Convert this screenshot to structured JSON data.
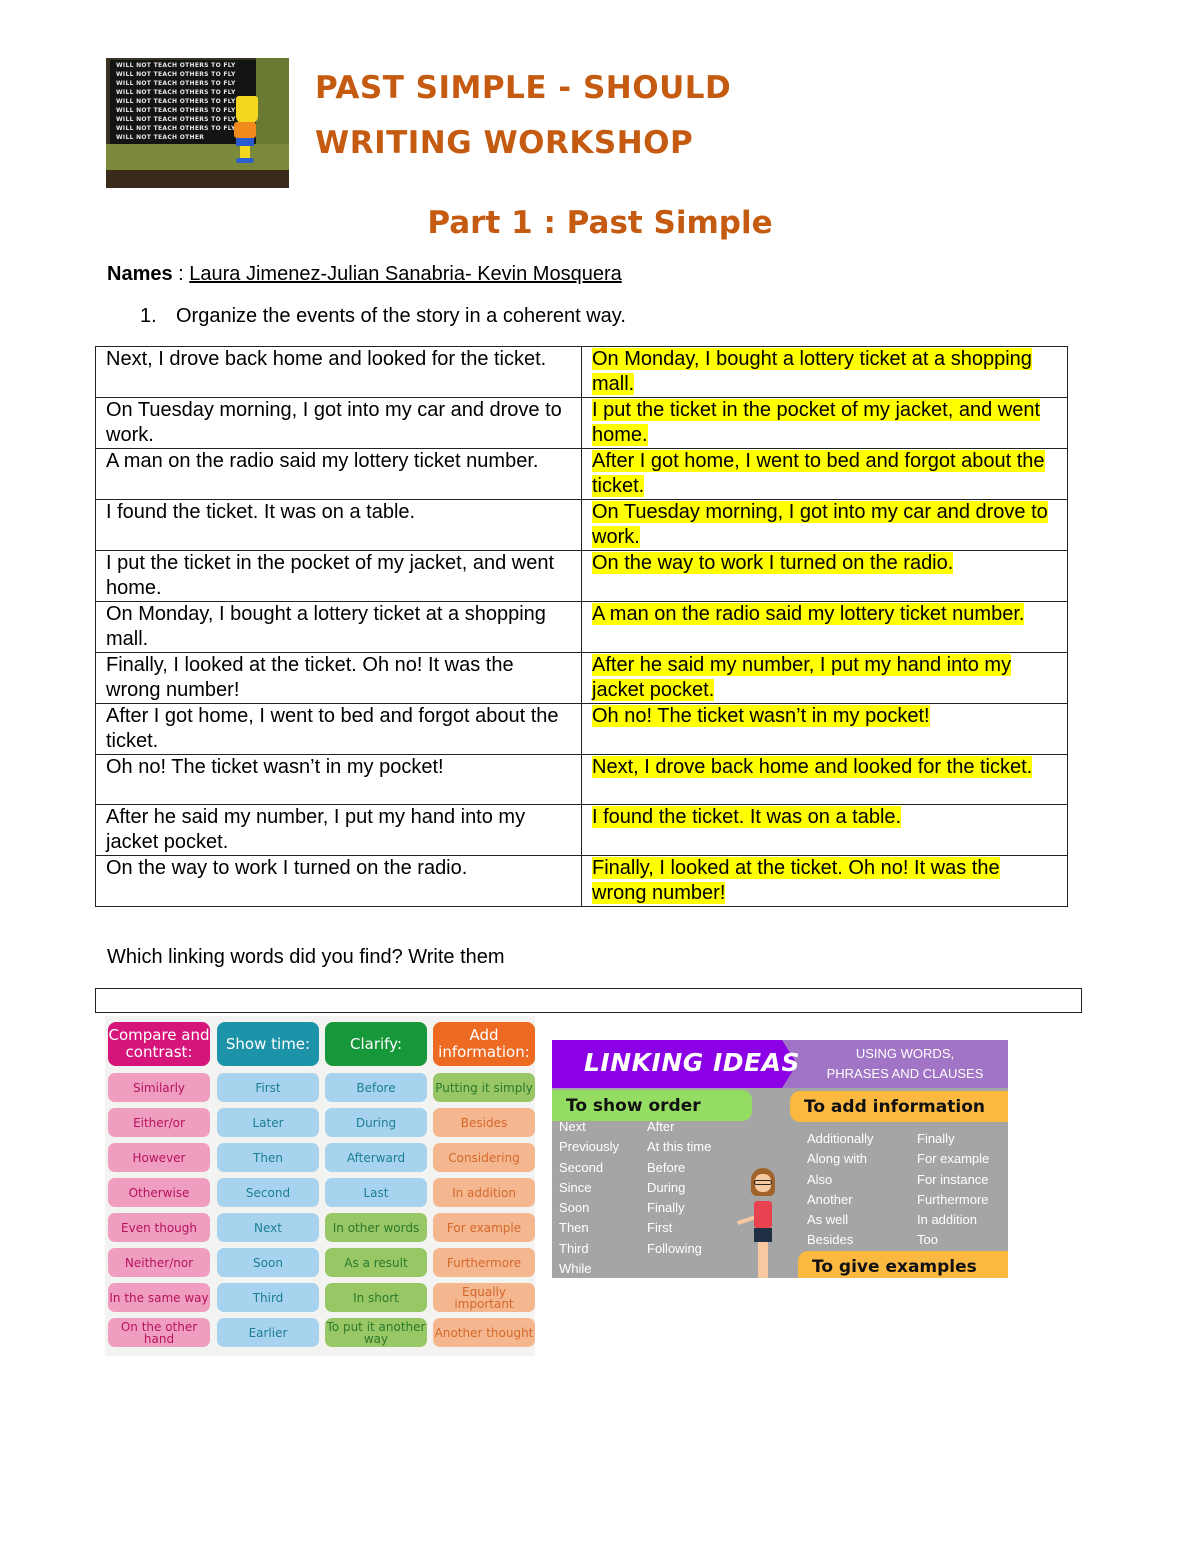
{
  "header": {
    "image": {
      "description": "Bart Simpson writing on a chalkboard",
      "chalk_lines": [
        "WILL NOT TEACH OTHERS TO FLY",
        "WILL NOT TEACH OTHERS TO FLY",
        "WILL NOT TEACH OTHERS TO FLY",
        "WILL NOT TEACH OTHERS TO FLY",
        "WILL NOT TEACH OTHERS TO FLY",
        "WILL NOT TEACH OTHERS TO FLY",
        "WILL NOT TEACH OTHERS TO FLY",
        "WILL NOT TEACH OTHERS TO FLY",
        "WILL NOT TEACH OTHER"
      ]
    },
    "title_line1": "PAST SIMPLE - SHOULD",
    "title_line2": "WRITING WORKSHOP",
    "part_title": "Part 1 : Past Simple",
    "accent_color": "#c55a11"
  },
  "names": {
    "label": "Names",
    "separator": " : ",
    "value": "Laura Jimenez-Julian Sanabria- Kevin Mosquera"
  },
  "instruction": {
    "number": "1.",
    "text": "Organize the events of the story in a coherent way."
  },
  "story_table": {
    "highlight_color": "#ffff00",
    "rows": [
      {
        "left": "Next, I drove back home and looked for the ticket.",
        "right": "On Monday, I bought a lottery ticket at a shopping mall."
      },
      {
        "left": "On Tuesday morning, I got into my car and drove to work.",
        "right": "I put the ticket in the pocket of my jacket, and went home."
      },
      {
        "left": "A man on the radio said my lottery ticket number.",
        "right": "After I got home, I went to bed and forgot about the ticket."
      },
      {
        "left": "I found the ticket. It was on a table.",
        "right": "On Tuesday morning, I got into my car and drove to work."
      },
      {
        "left": "I put the ticket in the pocket of my jacket, and went home.",
        "right": "On the way to work I turned on the radio."
      },
      {
        "left": "On Monday, I bought a lottery ticket at a shopping mall.",
        "right": "A man on the radio said my lottery ticket number."
      },
      {
        "left": "Finally, I looked at the ticket. Oh no! It was the wrong number!",
        "right": "After he said my number, I put my hand into my jacket pocket."
      },
      {
        "left": "After I got home, I went to bed and forgot about the ticket.",
        "right": "Oh no!  The ticket wasn’t in my pocket!"
      },
      {
        "left": "Oh no! The ticket wasn’t in my pocket!",
        "right": "Next, I drove back home and looked for the ticket."
      },
      {
        "left": "After he said my number, I put my hand into my jacket pocket.",
        "right": "I found the ticket.  It was on a table."
      },
      {
        "left": "On the way to work I turned on the radio.",
        "right": "Finally, I looked at the ticket.  Oh no!  It was the wrong number! "
      }
    ]
  },
  "question": {
    "text": "Which linking words did you find? Write them",
    "answer_value": ""
  },
  "linking_words_grid": {
    "columns": [
      {
        "heading": "Compare and contrast:",
        "color": "#d6157a",
        "pill_style": "pink",
        "items": [
          "Similarly",
          "Either/or",
          "However",
          "Otherwise",
          "Even though",
          "Neither/nor",
          "In the same way",
          "On the other hand"
        ]
      },
      {
        "heading": "Show time:",
        "color": "#1d93a9",
        "pill_style": "blue",
        "items": [
          "First",
          "Later",
          "Then",
          "Second",
          "Next",
          "Soon",
          "Third",
          "Earlier"
        ]
      },
      {
        "heading": "Clarify:",
        "color": "#16973a",
        "pill_style": "mixed",
        "items": [
          "Before",
          "During",
          "Afterward",
          "Last",
          "In other words",
          "As a result",
          "In short",
          "To put it another way"
        ],
        "item_styles": [
          "blue",
          "blue",
          "blue",
          "blue",
          "green",
          "green",
          "green",
          "green"
        ]
      },
      {
        "heading": "Add information:",
        "color": "#ec6a21",
        "pill_style": "orange",
        "items": [
          "Putting it simply",
          "Besides",
          "Considering",
          "In addition",
          "For example",
          "Furthermore",
          "Equally important",
          "Another thought"
        ],
        "item_styles": [
          "green",
          "orange",
          "orange",
          "orange",
          "orange",
          "orange",
          "orange",
          "orange"
        ]
      }
    ]
  },
  "linking_ideas": {
    "title": "LINKING IDEAS",
    "subtitle_line1": "USING WORDS,",
    "subtitle_line2": "PHRASES AND CLAUSES",
    "sections": {
      "show_order": {
        "heading": "To show order",
        "col1": [
          "Next",
          "Previously",
          "Second",
          "Since",
          "Soon",
          "Then",
          "Third",
          "While"
        ],
        "col2": [
          "After",
          "At this time",
          "Before",
          "During",
          "Finally",
          "First",
          "Following"
        ]
      },
      "add_information": {
        "heading": "To add information",
        "col1": [
          "Additionally",
          "Along with",
          "Also",
          "Another",
          "As well",
          "Besides"
        ],
        "col2": [
          "Finally",
          "For example",
          "For instance",
          "Furthermore",
          "In addition",
          "Too"
        ]
      },
      "give_examples": {
        "heading": "To give examples"
      }
    }
  }
}
